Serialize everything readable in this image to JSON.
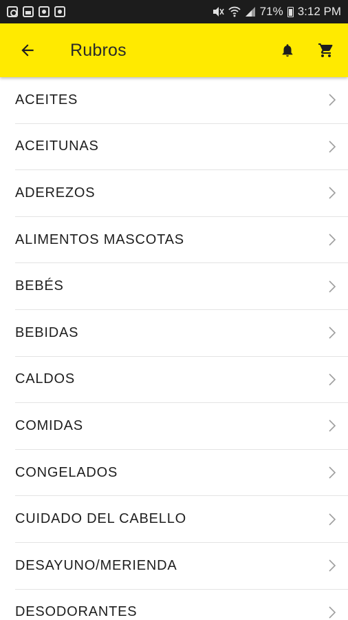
{
  "status_bar": {
    "battery": "71%",
    "time": "3:12 PM",
    "left_icons": [
      "instagram-icon",
      "gallery-icon",
      "app-icon",
      "app-icon"
    ]
  },
  "app_bar": {
    "title": "Rubros",
    "background": "#ffea00",
    "actions": [
      "bell-icon",
      "cart-icon"
    ]
  },
  "categories": [
    {
      "label": "ACEITES"
    },
    {
      "label": "ACEITUNAS"
    },
    {
      "label": "ADEREZOS"
    },
    {
      "label": "ALIMENTOS MASCOTAS"
    },
    {
      "label": "BEBÉS"
    },
    {
      "label": "BEBIDAS"
    },
    {
      "label": "CALDOS"
    },
    {
      "label": "COMIDAS"
    },
    {
      "label": "CONGELADOS"
    },
    {
      "label": "CUIDADO DEL CABELLO"
    },
    {
      "label": "DESAYUNO/MERIENDA"
    },
    {
      "label": "DESODORANTES"
    }
  ]
}
